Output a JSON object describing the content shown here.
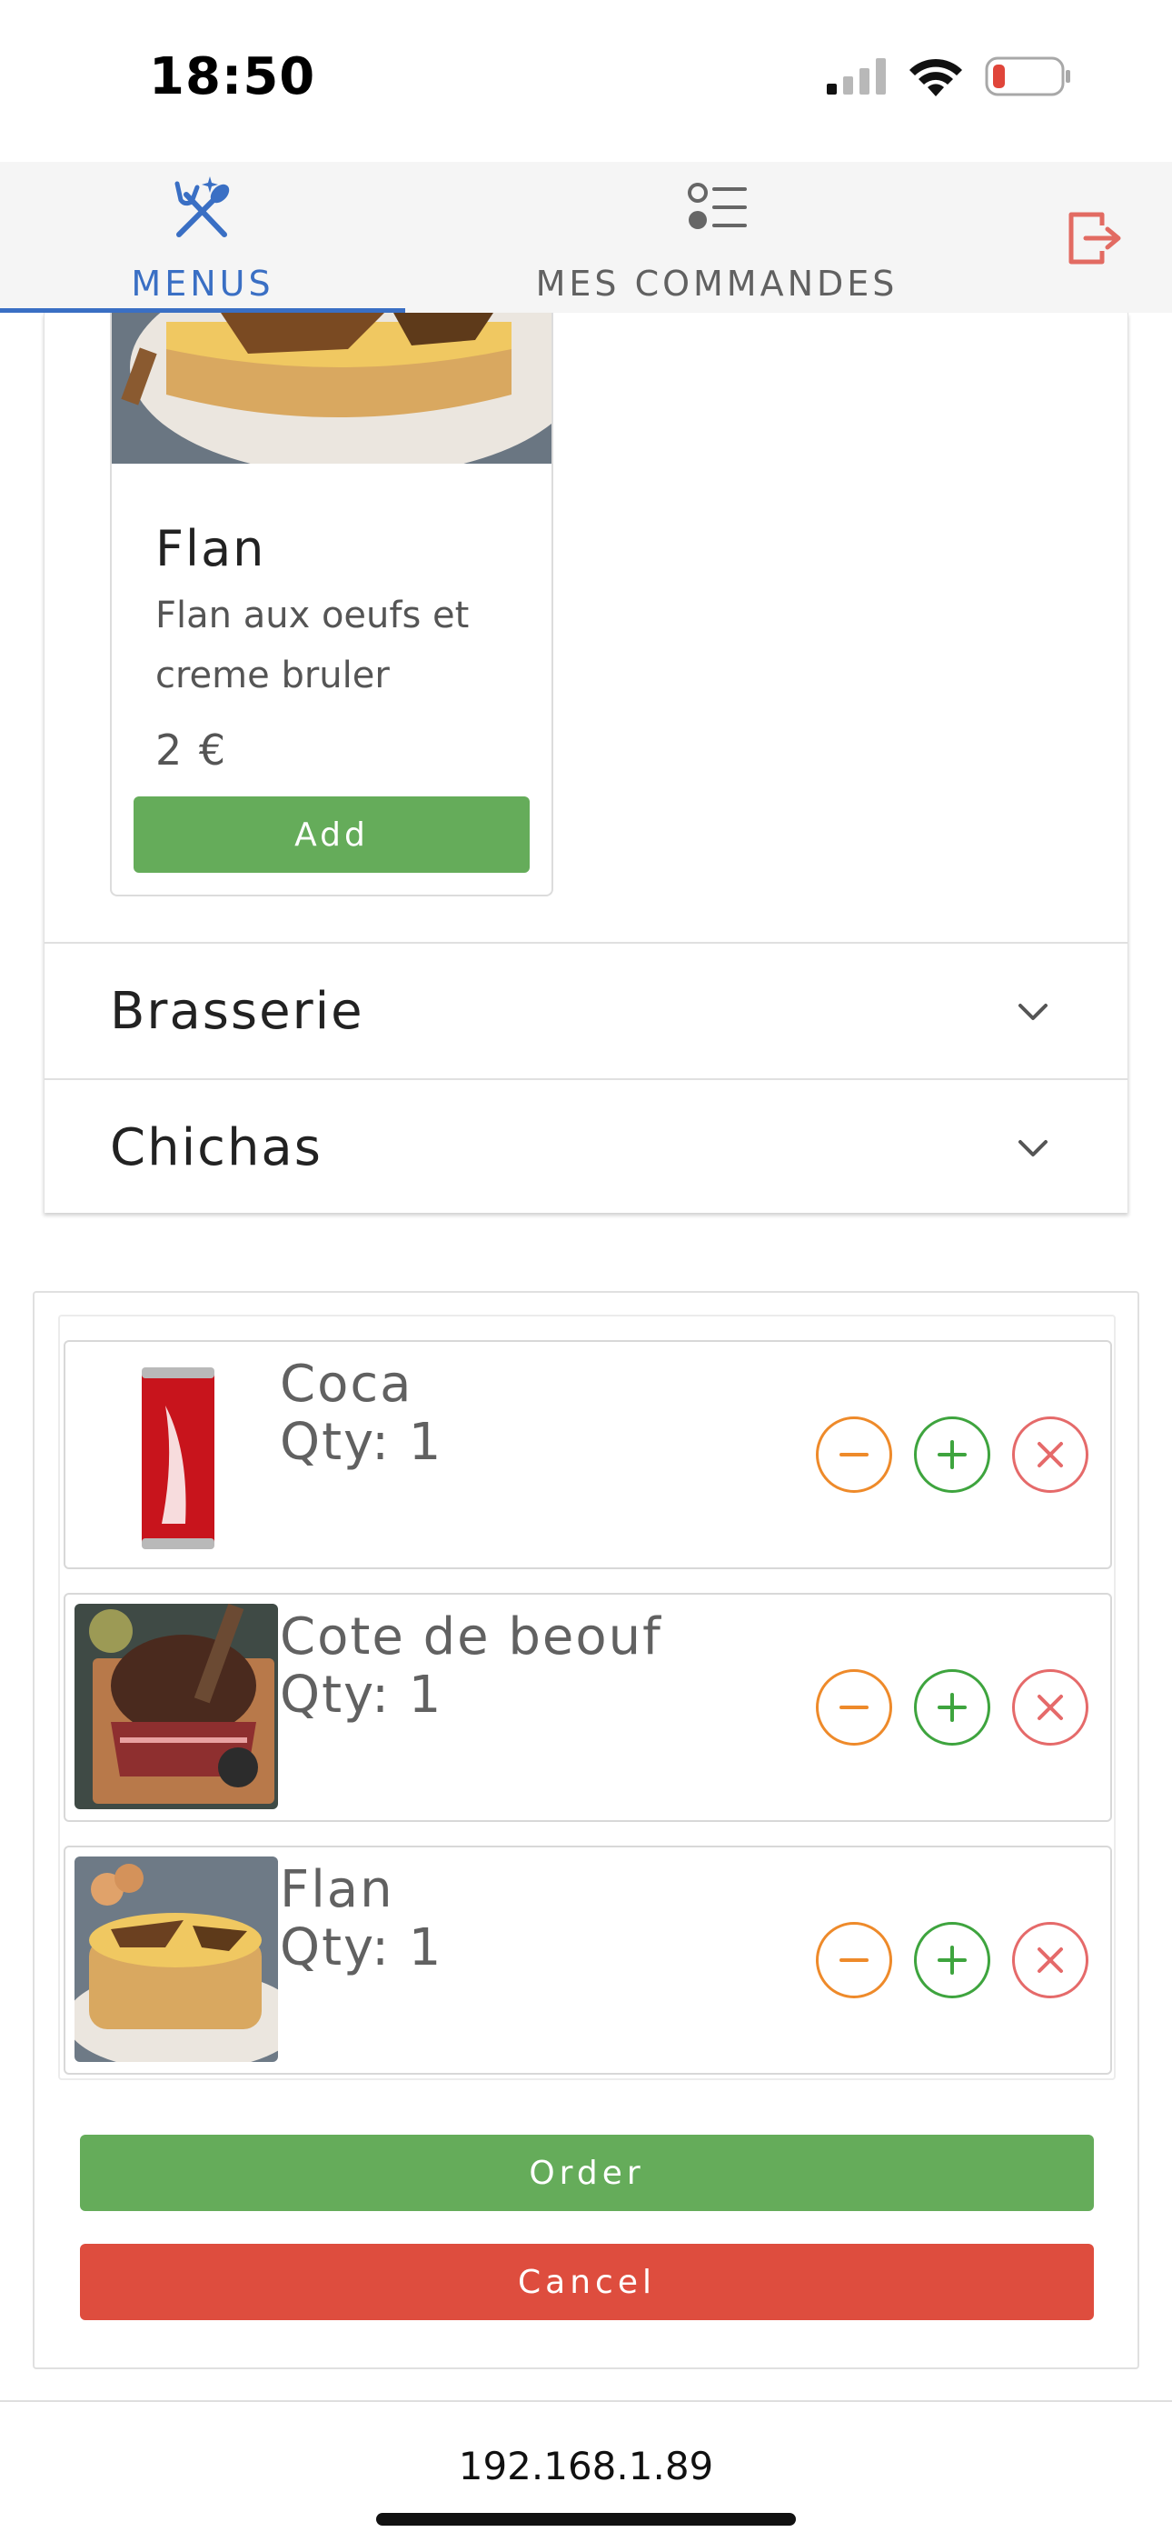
{
  "status_bar": {
    "time": "18:50",
    "icons": [
      "signal-icon",
      "wifi-icon",
      "battery-low-icon"
    ],
    "battery_color": "#e0453a"
  },
  "tabs": [
    {
      "label": "MENUS",
      "icon": "fork-knife-sparkle-icon",
      "active": true
    },
    {
      "label": "MES COMMANDES",
      "icon": "list-icon",
      "active": false
    }
  ],
  "logout": {
    "icon": "logout-icon",
    "color": "#e26b62"
  },
  "menu": {
    "product": {
      "name": "Flan",
      "description": "Flan aux oeufs et creme bruler",
      "price": "2 €",
      "add_label": "Add"
    },
    "sections": [
      {
        "title": "Brasserie"
      },
      {
        "title": "Chichas"
      }
    ]
  },
  "cart": {
    "items": [
      {
        "name": "Coca",
        "qty": "Qty: 1",
        "thumb": "coca-can"
      },
      {
        "name": "Cote de beouf",
        "qty": "Qty: 1",
        "thumb": "steak"
      },
      {
        "name": "Flan",
        "qty": "Qty: 1",
        "thumb": "flan"
      }
    ],
    "order_label": "Order",
    "cancel_label": "Cancel"
  },
  "colors": {
    "accent": "#3a6fc4",
    "order_green": "#65ac5a",
    "cancel_red": "#de4d3e",
    "minus_orange": "#ee8a2a",
    "plus_green": "#3ea43e",
    "remove_red": "#e56a6a"
  },
  "url": "192.168.1.89"
}
